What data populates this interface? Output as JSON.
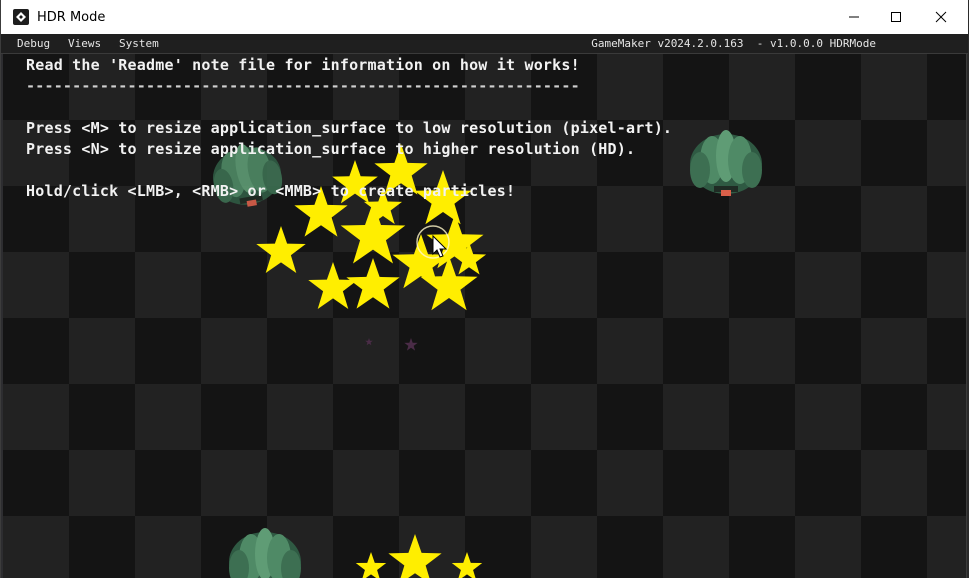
{
  "window": {
    "title": "HDR Mode",
    "controls": {
      "minimize": "minimize",
      "maximize": "maximize",
      "close": "close"
    }
  },
  "menubar": {
    "items": [
      "Debug",
      "Views",
      "System"
    ],
    "version": "GameMaker v2024.2.0.163  - v1.0.0.0 HDRMode"
  },
  "game": {
    "lines": [
      "Read the 'Readme' note file for information on how it works!",
      "------------------------------------------------------------",
      "Press <M> to resize application_surface to low resolution (pixel-art).",
      "Press <N> to resize application_surface to higher resolution (HD).",
      "Hold/click <LMB>, <RMB> or <MMB> to create particles!"
    ],
    "colors": {
      "star": "#ffee00",
      "checker_dark": "#141414",
      "checker_light": "#222222",
      "shrub": "#3c6b52",
      "text": "#f2f2f2"
    },
    "icons": [
      "star-particle-icon",
      "shrub-sprite-icon",
      "mouse-cursor-icon"
    ]
  }
}
